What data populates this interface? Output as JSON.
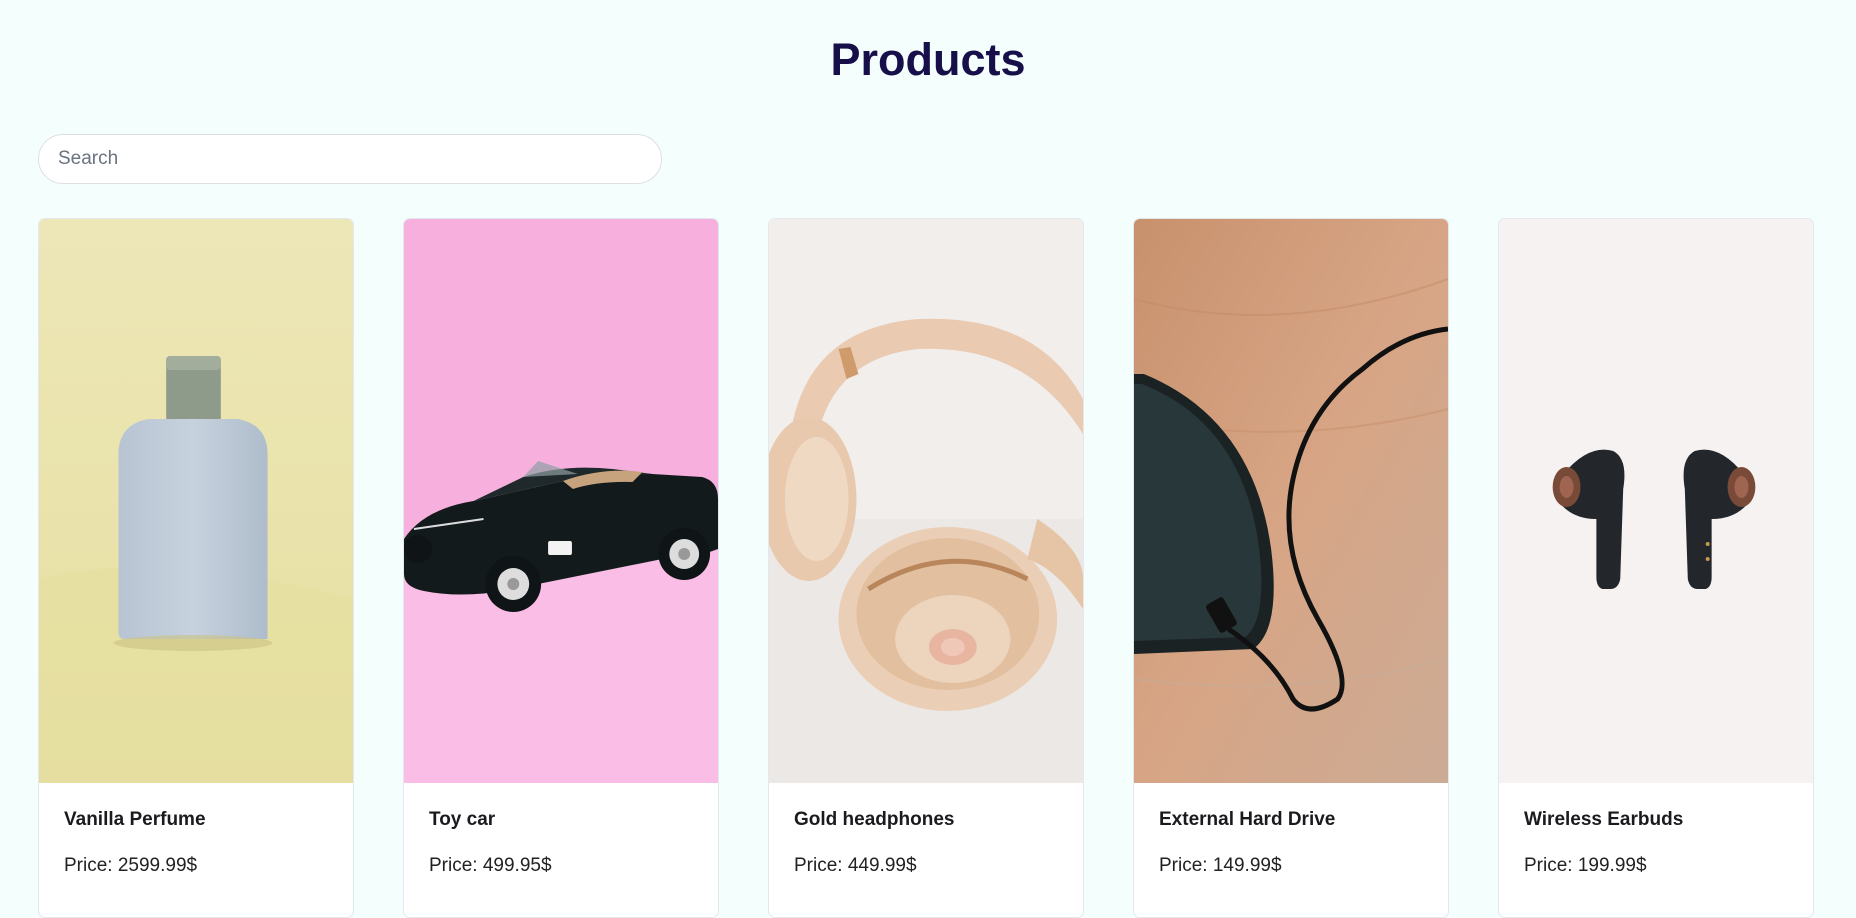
{
  "page": {
    "title": "Products"
  },
  "search": {
    "placeholder": "Search",
    "value": ""
  },
  "products": [
    {
      "name": "Vanilla Perfume",
      "price": "Price: 2599.99$",
      "image": "perfume-bottle"
    },
    {
      "name": "Toy car",
      "price": "Price: 499.95$",
      "image": "toy-car"
    },
    {
      "name": "Gold headphones",
      "price": "Price: 449.99$",
      "image": "headphones"
    },
    {
      "name": "External Hard Drive",
      "price": "Price: 149.99$",
      "image": "hard-drive"
    },
    {
      "name": "Wireless Earbuds",
      "price": "Price: 199.99$",
      "image": "earbuds"
    }
  ],
  "colors": {
    "background": "#f3fefd",
    "title": "#170f49",
    "card_background": "#ffffff"
  }
}
